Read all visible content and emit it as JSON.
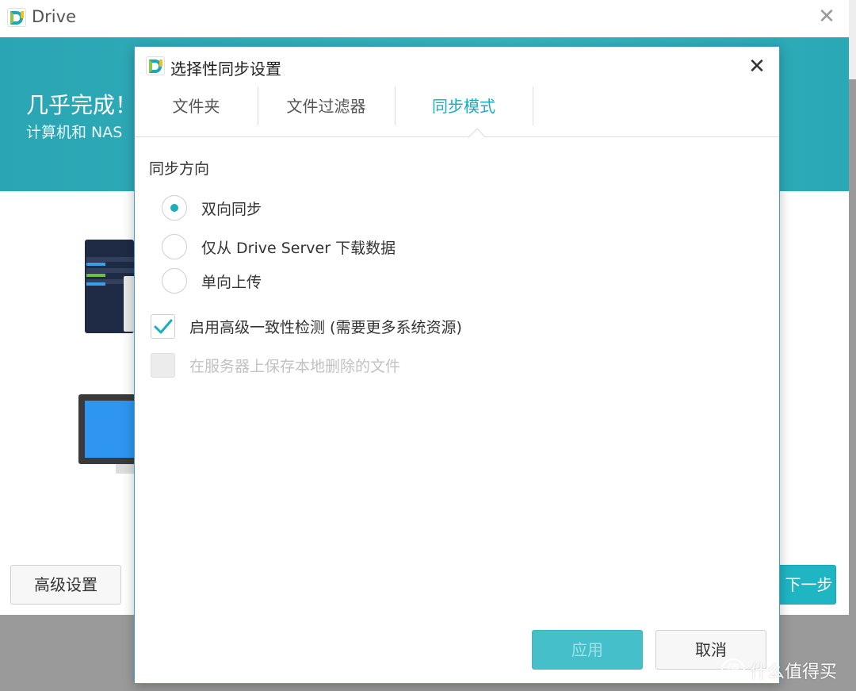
{
  "main_window": {
    "title": "Drive",
    "close_symbol": "✕",
    "banner": {
      "title": "几乎完成！",
      "subtitle": "计算机和 NAS"
    },
    "advanced_button": "高级设置",
    "next_button": "下一步"
  },
  "dialog": {
    "title": "选择性同步设置",
    "close_symbol": "✕",
    "tabs": [
      {
        "label": "文件夹",
        "active": false
      },
      {
        "label": "文件过滤器",
        "active": false
      },
      {
        "label": "同步模式",
        "active": true
      }
    ],
    "section_label": "同步方向",
    "sync_options": [
      {
        "label": "双向同步",
        "selected": true
      },
      {
        "label": "仅从 Drive Server 下载数据",
        "selected": false
      },
      {
        "label": "单向上传",
        "selected": false
      }
    ],
    "checkboxes": [
      {
        "label": "启用高级一致性检测 (需要更多系统资源)",
        "checked": true,
        "disabled": false
      },
      {
        "label": "在服务器上保存本地删除的文件",
        "checked": false,
        "disabled": true
      }
    ],
    "apply_button": "应用",
    "cancel_button": "取消"
  },
  "watermark": {
    "badge": "值",
    "text": "什么值得买"
  },
  "colors": {
    "accent": "#1aaebb",
    "banner": "#2aa5b3",
    "dialog_border": "#3b9fd6"
  },
  "icons": {
    "app_logo": "synology-drive-logo-icon",
    "close": "close-icon",
    "check": "checkmark-icon"
  }
}
